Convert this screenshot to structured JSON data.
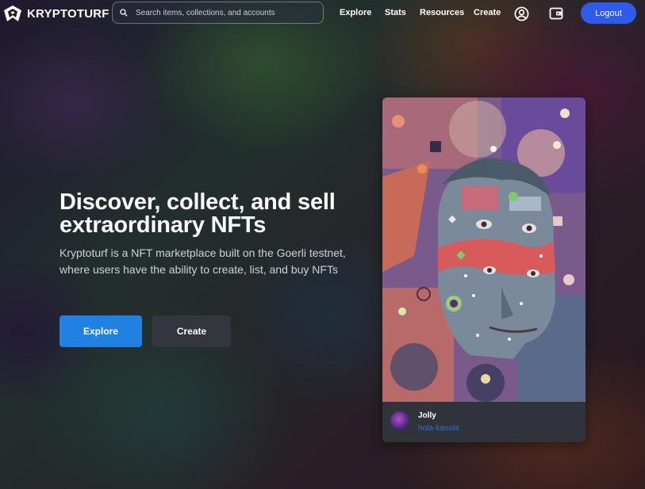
{
  "header": {
    "brand": "KRYPTOTURF",
    "search_placeholder": "Search items, collections, and accounts",
    "nav": [
      "Explore",
      "Stats",
      "Resources",
      "Create"
    ],
    "icons": [
      "account-circle-icon",
      "wallet-icon"
    ],
    "logout_label": "Logout"
  },
  "hero": {
    "title": "Discover, collect, and sell extraordinary NFTs",
    "description": "Kryptoturf is a NFT marketplace built on the Goerli testnet, where users have the ability to create, list, and buy NFTs",
    "explore_label": "Explore",
    "create_label": "Create"
  },
  "featured": {
    "name": "Jolly",
    "owner": "hola-kanola"
  },
  "colors": {
    "accent": "#2e5ce8",
    "explore_button": "#2081e2",
    "create_button": "#33363c",
    "card_footer": "#303339",
    "owner_link": "#2f6fd8"
  }
}
